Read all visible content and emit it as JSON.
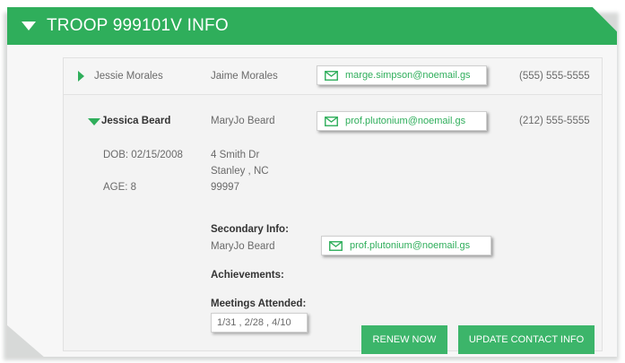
{
  "header": {
    "title": "TROOP 999101V INFO"
  },
  "members": [
    {
      "name": "Jessie Morales",
      "guardian": "Jaime Morales",
      "email": "marge.simpson@noemail.gs",
      "phone": "(555) 555-5555"
    },
    {
      "name": "Jessica Beard",
      "guardian": "MaryJo Beard",
      "email": "prof.plutonium@noemail.gs",
      "phone": "(212) 555-5555",
      "dob": "DOB: 02/15/2008",
      "age": "AGE: 8",
      "address": [
        "4 Smith Dr",
        "Stanley , NC",
        "99997"
      ],
      "secondary_label": "Secondary Info:",
      "secondary_name": "MaryJo Beard",
      "secondary_email": "prof.plutonium@noemail.gs",
      "achievements_label": "Achievements:",
      "meetings_label": "Meetings Attended:",
      "meetings_value": "1/31 , 2/28 , 4/10"
    }
  ],
  "buttons": {
    "renew": "RENEW NOW",
    "update": "UPDATE CONTACT INFO"
  },
  "colors": {
    "accent": "#2fae5b",
    "button": "#3cb56a"
  },
  "icons": {
    "expand": "triangle-down-icon",
    "collapsed": "triangle-right-icon",
    "email": "envelope-icon"
  }
}
